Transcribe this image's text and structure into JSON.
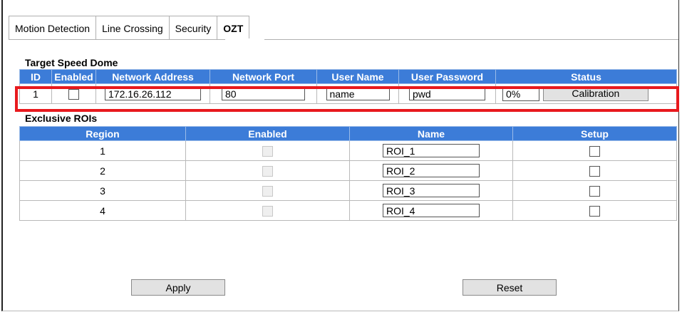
{
  "tabs": [
    {
      "label": "Motion Detection",
      "active": false
    },
    {
      "label": "Line Crossing",
      "active": false
    },
    {
      "label": "Security",
      "active": false
    },
    {
      "label": "OZT",
      "active": true
    }
  ],
  "target_speed_dome": {
    "title": "Target Speed Dome",
    "columns": [
      "ID",
      "Enabled",
      "Network Address",
      "Network Port",
      "User Name",
      "User Password",
      "Status"
    ],
    "row": {
      "id": "1",
      "enabled": false,
      "network_address": "172.16.26.112",
      "network_port": "80",
      "user_name": "name",
      "user_password": "pwd",
      "status_value": "0%",
      "calibration_label": "Calibration"
    }
  },
  "exclusive_rois": {
    "title": "Exclusive ROIs",
    "columns": [
      "Region",
      "Enabled",
      "Name",
      "Setup"
    ],
    "rows": [
      {
        "region": "1",
        "name": "ROI_1"
      },
      {
        "region": "2",
        "name": "ROI_2"
      },
      {
        "region": "3",
        "name": "ROI_3"
      },
      {
        "region": "4",
        "name": "ROI_4"
      }
    ]
  },
  "buttons": {
    "apply": "Apply",
    "reset": "Reset"
  },
  "colors": {
    "header_blue": "#3c7cd8",
    "highlight_red": "#e8191d"
  }
}
